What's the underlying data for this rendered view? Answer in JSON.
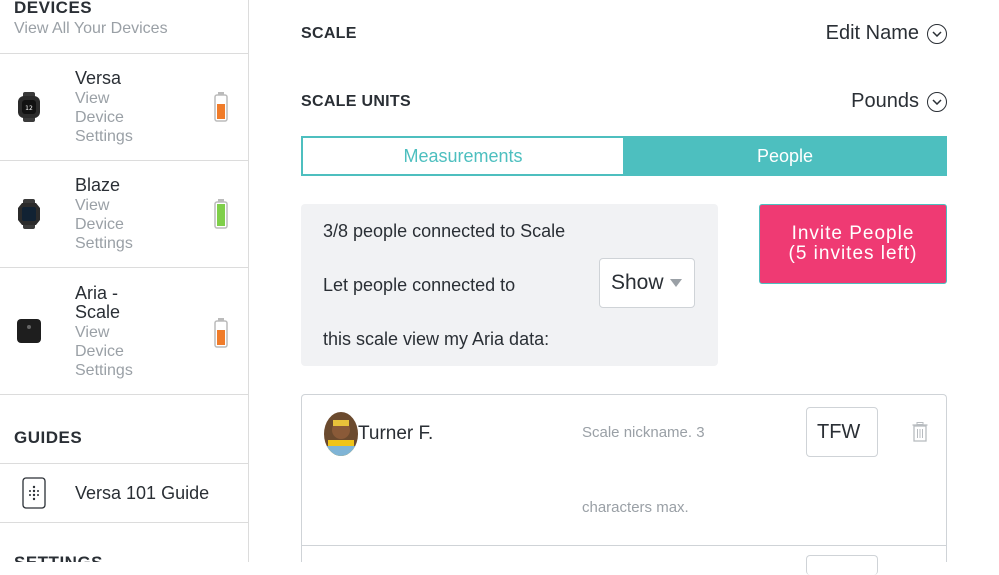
{
  "sidebar": {
    "devices_title": "DEVICES",
    "devices_sub": "View All Your Devices",
    "devices": [
      {
        "name": "Versa",
        "link": [
          "View",
          "Device",
          "Settings"
        ],
        "battery": "low",
        "battery_color": "#f07c2a"
      },
      {
        "name": "Blaze",
        "link": [
          "View",
          "Device",
          "Settings"
        ],
        "battery": "full",
        "battery_color": "#7fcf4a"
      },
      {
        "name": [
          "Aria -",
          "Scale"
        ],
        "link": [
          "View",
          "Device",
          "Settings"
        ],
        "battery": "low",
        "battery_color": "#f07c2a"
      }
    ],
    "guides_title": "GUIDES",
    "guide_label": "Versa 101 Guide",
    "settings_title": "SETTINGS"
  },
  "scale": {
    "label": "SCALE",
    "edit_label": "Edit Name",
    "units_label": "SCALE UNITS",
    "units_value": "Pounds"
  },
  "tabs": {
    "measurements": "Measurements",
    "people": "People",
    "active": "People"
  },
  "info": {
    "connected": "3/8 people connected to Scale",
    "line1": "Let people connected to",
    "line2": "this scale view my Aria data:",
    "select_value": "Show"
  },
  "invite": {
    "line1": "Invite People",
    "line2": "(5 invites left)"
  },
  "people": [
    {
      "name": "Turner F.",
      "hint1": "Scale nickname. 3",
      "hint2": "characters max.",
      "nickname": "TFW"
    }
  ],
  "colors": {
    "accent": "#4dbfbf",
    "invite": "#ef3a73"
  }
}
